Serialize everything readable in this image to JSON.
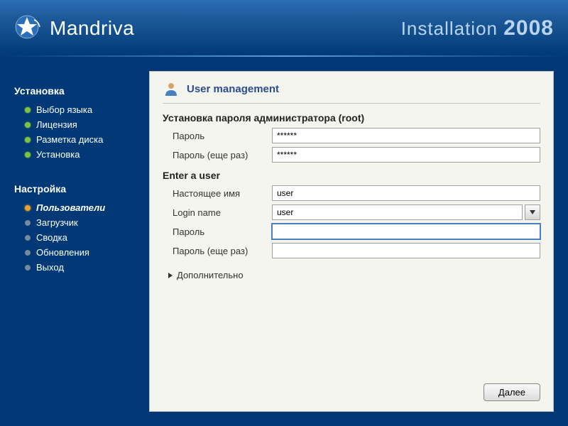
{
  "header": {
    "brand": "Mandriva",
    "title_prefix": "Installation",
    "title_year": "2008"
  },
  "sidebar": {
    "sections": [
      {
        "title": "Установка",
        "items": [
          {
            "label": "Выбор языка",
            "status": "done"
          },
          {
            "label": "Лицензия",
            "status": "done"
          },
          {
            "label": "Разметка диска",
            "status": "done"
          },
          {
            "label": "Установка",
            "status": "done"
          }
        ]
      },
      {
        "title": "Настройка",
        "items": [
          {
            "label": "Пользователи",
            "status": "current"
          },
          {
            "label": "Загрузчик",
            "status": "pending"
          },
          {
            "label": "Сводка",
            "status": "pending"
          },
          {
            "label": "Обновления",
            "status": "pending"
          },
          {
            "label": "Выход",
            "status": "pending"
          }
        ]
      }
    ]
  },
  "panel": {
    "title": "User management",
    "root_section": {
      "heading": "Установка пароля администратора (root)",
      "password_label": "Пароль",
      "password_value": "******",
      "password2_label": "Пароль (еще раз)",
      "password2_value": "******"
    },
    "user_section": {
      "heading": "Enter a user",
      "realname_label": "Настоящее имя",
      "realname_value": "user",
      "login_label": "Login name",
      "login_value": "user",
      "password_label": "Пароль",
      "password_value": "",
      "password2_label": "Пароль (еще раз)",
      "password2_value": ""
    },
    "advanced_label": "Дополнительно",
    "next_button": "Далее"
  }
}
